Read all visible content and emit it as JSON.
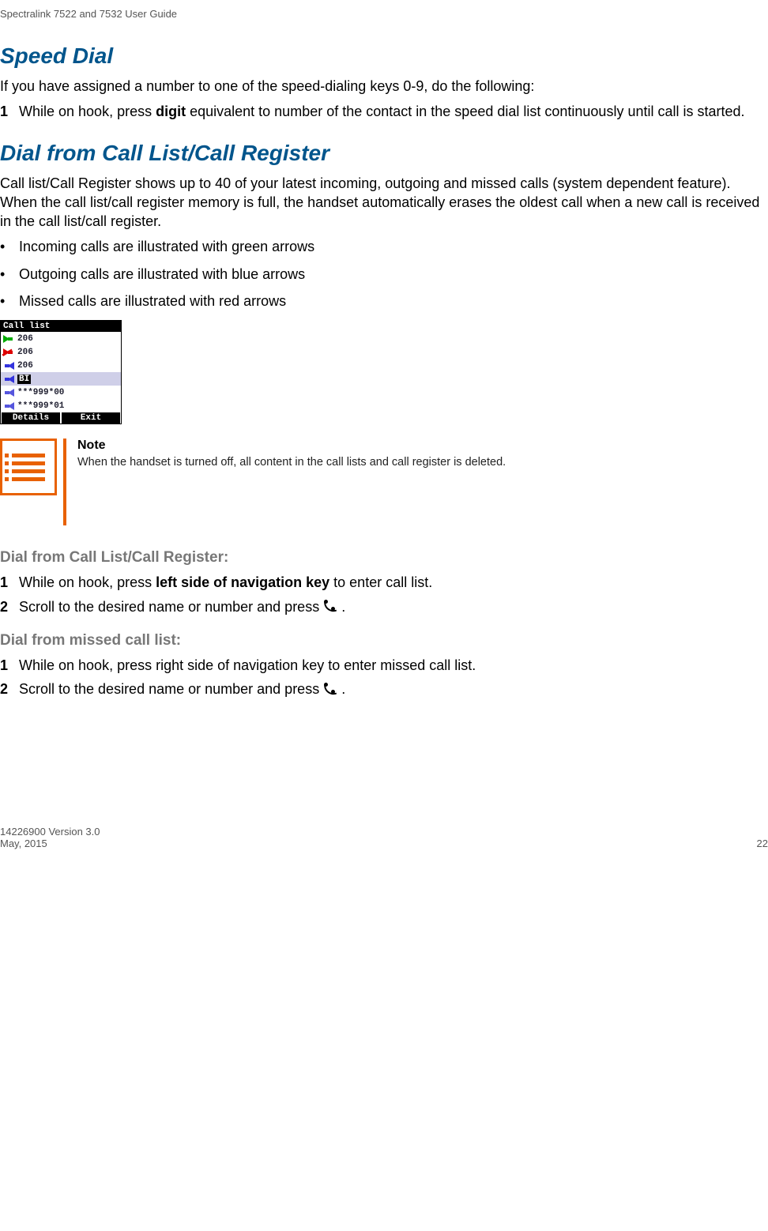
{
  "running_header": "Spectralink 7522 and 7532 User Guide",
  "speed_dial": {
    "title": "Speed Dial",
    "intro": "If you have assigned a number to one of the speed-dialing keys 0-9, do the following:",
    "step1_pre": "While on hook, press ",
    "step1_bold": "digit",
    "step1_post": " equivalent to number of the contact in the speed dial list continuously until call is started."
  },
  "call_register": {
    "title": "Dial from Call List/Call Register",
    "intro": "Call list/Call Register shows up to 40 of your latest incoming, outgoing and missed calls (system dependent feature). When the call list/call register memory is full, the handset automatically erases the oldest call when a new call is received in the call list/call register.",
    "bullets": [
      "Incoming calls are illustrated with green arrows",
      "Outgoing calls are illustrated with blue arrows",
      "Missed calls are illustrated with red arrows"
    ]
  },
  "call_list_img": {
    "header": "Call list",
    "rows": [
      {
        "arrow": "green",
        "text": "206"
      },
      {
        "arrow": "red",
        "text": "206"
      },
      {
        "arrow": "blue",
        "text": "206"
      },
      {
        "arrow": "blue",
        "text": "BI",
        "selected": true
      },
      {
        "arrow": "purple",
        "text": "***999*00"
      },
      {
        "arrow": "purple",
        "text": "***999*01"
      }
    ],
    "footer_left": "Details",
    "footer_right": "Exit"
  },
  "note": {
    "title": "Note",
    "body": "When the handset is turned off, all content in the call lists and call register is deleted."
  },
  "dial_from_list": {
    "heading": "Dial from Call List/Call Register:",
    "step1_pre": "While on hook, press ",
    "step1_bold": "left side of navigation key",
    "step1_post": " to enter call list.",
    "step2_pre": "Scroll to the desired name or number and press ",
    "step2_post": " ."
  },
  "dial_from_missed": {
    "heading": "Dial from missed call list:",
    "step1": "While on hook, press right side of navigation key to enter missed call list.",
    "step2_pre": "Scroll to the desired name or number and press ",
    "step2_post": " ."
  },
  "footer": {
    "left_line1": "14226900 Version 3.0",
    "left_line2": "May, 2015",
    "right": "22"
  }
}
